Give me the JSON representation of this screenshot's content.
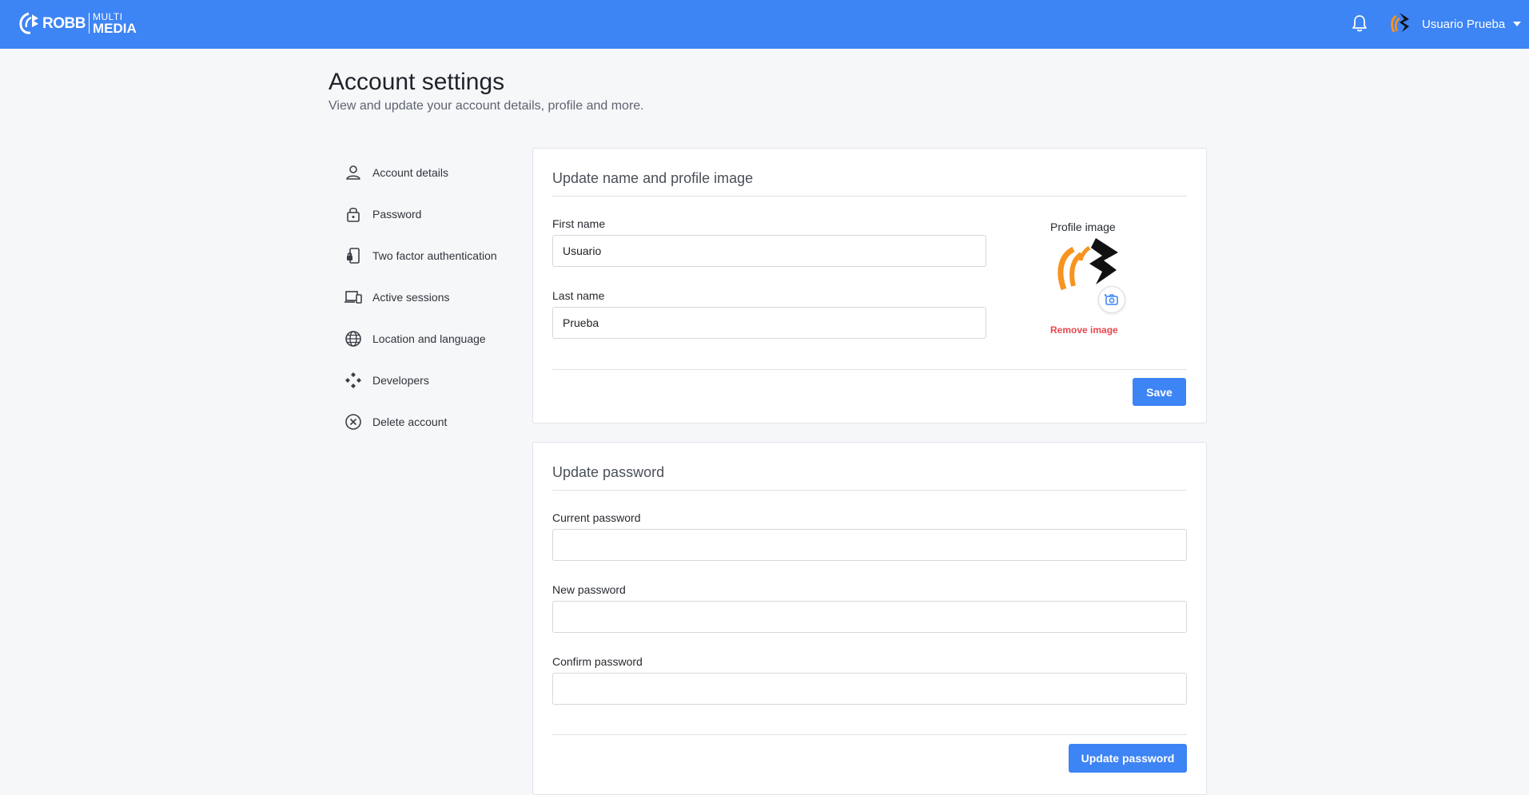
{
  "header": {
    "logo": {
      "primary": "ROBB",
      "secondary_top": "MULTI",
      "secondary_bottom": "MEDIA"
    },
    "user_name": "Usuario Prueba",
    "brand_color": "#3d84f5"
  },
  "page": {
    "title": "Account settings",
    "subtitle": "View and update your account details, profile and more."
  },
  "nav": {
    "items": [
      {
        "label": "Account details",
        "icon": "user-icon"
      },
      {
        "label": "Password",
        "icon": "lock-icon"
      },
      {
        "label": "Two factor authentication",
        "icon": "phone-lock-icon"
      },
      {
        "label": "Active sessions",
        "icon": "devices-icon"
      },
      {
        "label": "Location and language",
        "icon": "globe-icon"
      },
      {
        "label": "Developers",
        "icon": "developers-icon"
      },
      {
        "label": "Delete account",
        "icon": "close-circle-icon"
      }
    ]
  },
  "profile_card": {
    "title": "Update name and profile image",
    "first_name_label": "First name",
    "first_name_value": "Usuario",
    "last_name_label": "Last name",
    "last_name_value": "Prueba",
    "profile_image_label": "Profile image",
    "remove_image_label": "Remove image",
    "save_label": "Save"
  },
  "password_card": {
    "title": "Update password",
    "current_label": "Current password",
    "current_value": "",
    "new_label": "New password",
    "new_value": "",
    "confirm_label": "Confirm password",
    "confirm_value": "",
    "submit_label": "Update password"
  }
}
